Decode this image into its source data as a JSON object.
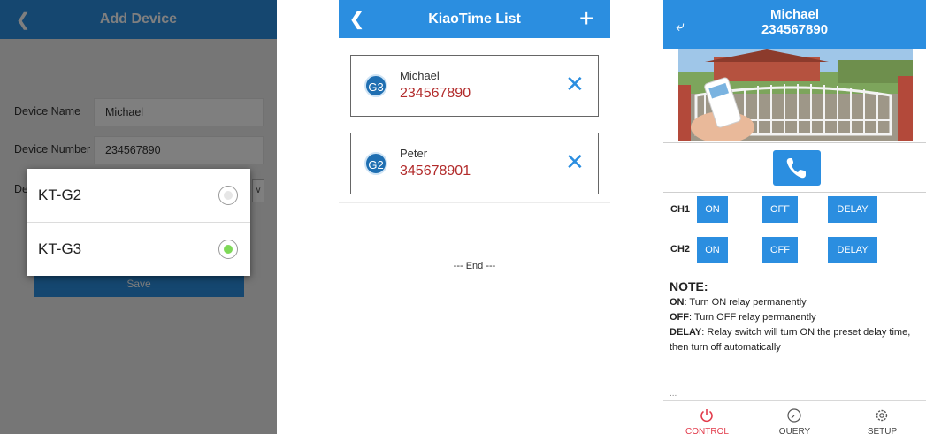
{
  "add_device": {
    "title": "Add Device",
    "device_name_label": "Device Name",
    "device_name_value": "Michael",
    "device_number_label": "Device Number",
    "device_number_value": "234567890",
    "device_type_label_partial": "De",
    "save_label": "Save",
    "dialog_options": [
      {
        "label": "KT-G2",
        "selected": false
      },
      {
        "label": "KT-G3",
        "selected": true
      }
    ],
    "colors": {
      "header": "#2b8ee0",
      "radio_selected": "#7ed957"
    }
  },
  "list": {
    "title": "KiaoTime List",
    "items": [
      {
        "badge": "G3",
        "name": "Michael",
        "number": "234567890"
      },
      {
        "badge": "G2",
        "name": "Peter",
        "number": "345678901"
      }
    ],
    "end_text": "--- End ---"
  },
  "control": {
    "header_name": "Michael",
    "header_number": "234567890",
    "channels": [
      {
        "label": "CH1",
        "on": "ON",
        "off": "OFF",
        "delay": "DELAY"
      },
      {
        "label": "CH2",
        "on": "ON",
        "off": "OFF",
        "delay": "DELAY"
      }
    ],
    "note_title": "NOTE:",
    "notes": [
      {
        "key": "ON",
        "text": ": Turn ON relay permanently"
      },
      {
        "key": "OFF",
        "text": ": Turn OFF relay permanently"
      },
      {
        "key": "DELAY",
        "text": ": Relay switch will turn ON the preset delay time,"
      },
      {
        "key": "",
        "text": "then turn off automatically"
      }
    ],
    "ellipsis": "...",
    "tabs": [
      {
        "label": "CONTROL",
        "icon": "power-icon",
        "active": true
      },
      {
        "label": "QUERY",
        "icon": "clock-icon",
        "active": false
      },
      {
        "label": "SETUP",
        "icon": "gear-icon",
        "active": false
      }
    ],
    "colors": {
      "active_tab": "#e23b4b",
      "inactive_tab": "#444444"
    }
  }
}
